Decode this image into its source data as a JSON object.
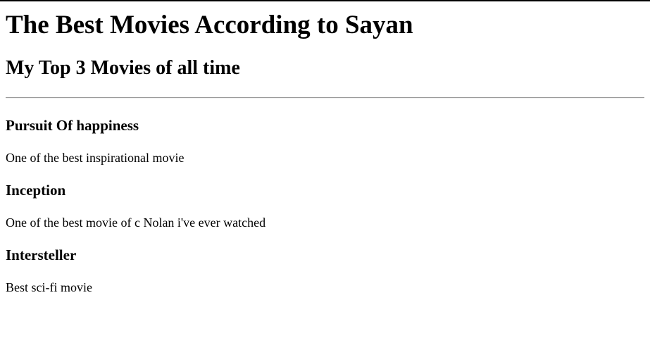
{
  "page": {
    "title": "The Best Movies According to Sayan",
    "subtitle": "My Top 3 Movies of all time"
  },
  "movies": [
    {
      "title": "Pursuit Of happiness",
      "description": "One of the best inspirational movie"
    },
    {
      "title": "Inception",
      "description": "One of the best movie of c Nolan i've ever watched"
    },
    {
      "title": "Intersteller",
      "description": "Best sci-fi movie"
    }
  ]
}
